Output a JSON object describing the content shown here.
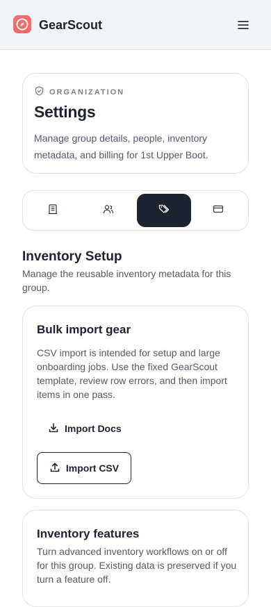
{
  "app": {
    "brand_name": "GearScout",
    "icons": {
      "logo": "compass-icon",
      "menu": "hamburger-menu-icon"
    },
    "colors": {
      "brand": "#f26d6d",
      "dark": "#1d2430"
    }
  },
  "header": {
    "eyebrow": "ORGANIZATION",
    "title": "Settings",
    "description": "Manage group details, people, inventory metadata, and billing for 1st Upper Boot."
  },
  "tabs": [
    {
      "icon": "building-icon",
      "active": false
    },
    {
      "icon": "users-icon",
      "active": false
    },
    {
      "icon": "tags-icon",
      "active": true
    },
    {
      "icon": "credit-card-icon",
      "active": false
    }
  ],
  "inventory_setup": {
    "title": "Inventory Setup",
    "description": "Manage the reusable inventory metadata for this group."
  },
  "bulk_import": {
    "title": "Bulk import gear",
    "description": "CSV import is intended for setup and large onboarding jobs. Use the fixed GearScout template, review row errors, and then import items in one pass.",
    "docs_label": "Import Docs",
    "csv_label": "Import CSV"
  },
  "inventory_features": {
    "title": "Inventory features",
    "description": "Turn advanced inventory workflows on or off for this group. Existing data is preserved if you turn a feature off."
  }
}
